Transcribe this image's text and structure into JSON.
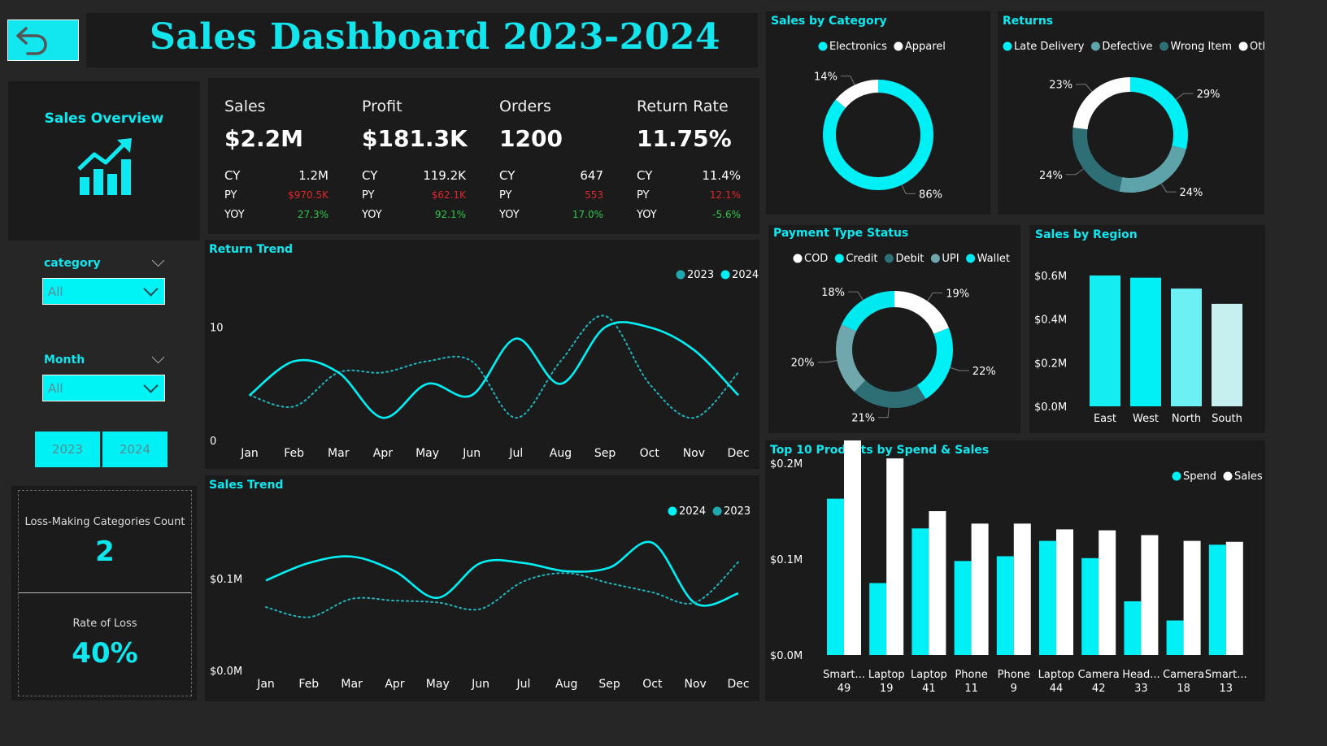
{
  "header": {
    "title": "Sales Dashboard  2023-2024"
  },
  "overview": {
    "label": "Sales Overview"
  },
  "filters": {
    "category": {
      "label": "category",
      "value": "All"
    },
    "month": {
      "label": "Month",
      "value": "All"
    },
    "years": [
      "2023",
      "2024"
    ]
  },
  "loss": {
    "count_label": "Loss-Making Categories Count",
    "count_value": "2",
    "rate_label": "Rate of Loss",
    "rate_value": "40%"
  },
  "kpis": [
    {
      "name": "Sales",
      "value": "$2.2M",
      "cy_label": "CY",
      "cy": "1.2M",
      "py_label": "PY",
      "py": "$970.5K",
      "yoy_label": "YOY",
      "yoy": "27.3%",
      "yoy_positive": true
    },
    {
      "name": "Profit",
      "value": "$181.3K",
      "cy_label": "CY",
      "cy": "119.2K",
      "py_label": "PY",
      "py": "$62.1K",
      "yoy_label": "YOY",
      "yoy": "92.1%",
      "yoy_positive": true
    },
    {
      "name": "Orders",
      "value": "1200",
      "cy_label": "CY",
      "cy": "647",
      "py_label": "PY",
      "py": "553",
      "yoy_label": "YOY",
      "yoy": "17.0%",
      "yoy_positive": true
    },
    {
      "name": "Return Rate",
      "value": "11.75%",
      "cy_label": "CY",
      "cy": "11.4%",
      "py_label": "PY",
      "py": "12.1%",
      "yoy_label": "YOY",
      "yoy": "-5.6%",
      "yoy_positive": true
    }
  ],
  "colors": {
    "accent": "#00f0f5",
    "teal_dark": "#2d6f74",
    "teal_mid": "#5fa3aa",
    "white": "#ffffff",
    "panel": "#1b1b1b",
    "bg": "#262626"
  },
  "chart_data": [
    {
      "id": "return_trend",
      "type": "line",
      "title": "Return Trend",
      "x": [
        "Jan",
        "Feb",
        "Mar",
        "Apr",
        "May",
        "Jun",
        "Jul",
        "Aug",
        "Sep",
        "Oct",
        "Nov",
        "Dec"
      ],
      "yticks": [
        "0",
        "10"
      ],
      "ylim": [
        0,
        14
      ],
      "series": [
        {
          "name": "2023",
          "style": "dotted",
          "color": "#1fb5bb",
          "values": [
            4,
            3,
            6,
            6,
            7,
            7,
            2,
            7,
            11,
            5,
            2,
            6
          ]
        },
        {
          "name": "2024",
          "style": "solid",
          "color": "#00f0f5",
          "values": [
            4,
            7,
            6,
            2,
            5,
            4,
            9,
            5,
            10,
            10,
            8,
            4
          ]
        }
      ],
      "legend_order": [
        "2023",
        "2024"
      ],
      "legend": "top-right"
    },
    {
      "id": "sales_trend",
      "type": "line",
      "title": "Sales Trend",
      "x": [
        "Jan",
        "Feb",
        "Mar",
        "Apr",
        "May",
        "Jun",
        "Jul",
        "Aug",
        "Sep",
        "Oct",
        "Nov",
        "Dec"
      ],
      "yticks": [
        "$0.0M",
        "$0.1M"
      ],
      "ylim": [
        0,
        0.2
      ],
      "series": [
        {
          "name": "2024",
          "style": "solid",
          "color": "#00f0f5",
          "values": [
            0.098,
            0.117,
            0.124,
            0.108,
            0.079,
            0.117,
            0.117,
            0.108,
            0.112,
            0.139,
            0.073,
            0.084
          ]
        },
        {
          "name": "2023",
          "style": "dotted",
          "color": "#1fb5bb",
          "values": [
            0.069,
            0.058,
            0.078,
            0.076,
            0.074,
            0.067,
            0.097,
            0.106,
            0.095,
            0.085,
            0.074,
            0.118
          ]
        }
      ],
      "legend_order": [
        "2024",
        "2023"
      ],
      "legend": "top-right"
    },
    {
      "id": "sales_by_category",
      "type": "pie",
      "donut": true,
      "title": "Sales by Category",
      "slices": [
        {
          "name": "Electronics",
          "value": 86,
          "label": "86%",
          "color": "#00f0f5"
        },
        {
          "name": "Apparel",
          "value": 14,
          "label": "14%",
          "color": "#ffffff"
        }
      ]
    },
    {
      "id": "returns",
      "type": "pie",
      "donut": true,
      "title": "Returns",
      "slices": [
        {
          "name": "Late Delivery",
          "value": 29,
          "label": "29%",
          "color": "#00f0f5"
        },
        {
          "name": "Defective",
          "value": 24,
          "label": "24%",
          "color": "#5fa3aa"
        },
        {
          "name": "Wrong Item",
          "value": 24,
          "label": "24%",
          "color": "#2d6f74"
        },
        {
          "name": "Other",
          "value": 23,
          "label": "23%",
          "color": "#ffffff"
        }
      ]
    },
    {
      "id": "payment_type",
      "type": "pie",
      "donut": true,
      "title": "Payment Type Status",
      "slices": [
        {
          "name": "COD",
          "value": 19,
          "label": "19%",
          "color": "#ffffff"
        },
        {
          "name": "Credit",
          "value": 22,
          "label": "22%",
          "color": "#00f0f5"
        },
        {
          "name": "Debit",
          "value": 21,
          "label": "21%",
          "color": "#2d6f74"
        },
        {
          "name": "UPI",
          "value": 20,
          "label": "20%",
          "color": "#6fa7ac"
        },
        {
          "name": "Wallet",
          "value": 18,
          "label": "18%",
          "color": "#00e8f0"
        }
      ]
    },
    {
      "id": "sales_by_region",
      "type": "bar",
      "title": "Sales by Region",
      "categories": [
        "East",
        "West",
        "North",
        "South"
      ],
      "values": [
        0.6,
        0.59,
        0.54,
        0.47
      ],
      "colors": [
        "#14eef2",
        "#00f0f5",
        "#6cf0f3",
        "#c6eff0"
      ],
      "yticks": [
        "$0.0M",
        "$0.2M",
        "$0.4M",
        "$0.6M"
      ],
      "ylim": [
        0,
        0.6
      ]
    },
    {
      "id": "top_products",
      "type": "bar",
      "title": "Top 10 Products by Spend & Sales",
      "categories": [
        [
          "Smart...",
          "49"
        ],
        [
          "Laptop",
          "19"
        ],
        [
          "Laptop",
          "41"
        ],
        [
          "Phone",
          "11"
        ],
        [
          "Phone",
          "9"
        ],
        [
          "Laptop",
          "44"
        ],
        [
          "Camera",
          "42"
        ],
        [
          "Head...",
          "33"
        ],
        [
          "Camera",
          "18"
        ],
        [
          "Smart...",
          "13"
        ]
      ],
      "series": [
        {
          "name": "Spend",
          "color": "#00f0f5",
          "values": [
            0.163,
            0.075,
            0.132,
            0.098,
            0.103,
            0.119,
            0.101,
            0.056,
            0.036,
            0.115
          ]
        },
        {
          "name": "Sales",
          "color": "#ffffff",
          "values": [
            0.225,
            0.205,
            0.15,
            0.137,
            0.137,
            0.131,
            0.13,
            0.125,
            0.119,
            0.118
          ]
        }
      ],
      "yticks": [
        "$0.0M",
        "$0.1M",
        "$0.2M"
      ],
      "ylim": [
        0,
        0.2
      ]
    }
  ]
}
